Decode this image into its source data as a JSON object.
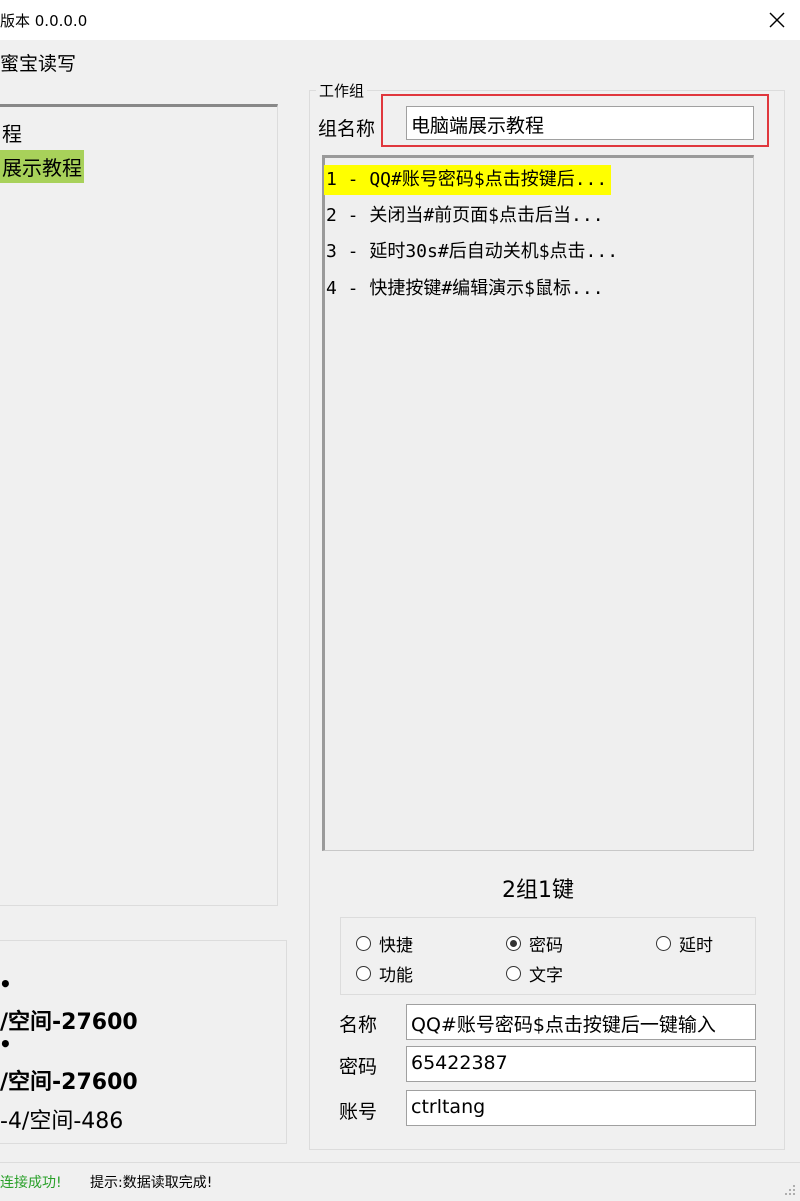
{
  "window": {
    "title": "版本 0.0.0.0",
    "close_symbol": "✕"
  },
  "menu": {
    "item": "蜜宝读写"
  },
  "tree": {
    "items": [
      {
        "label": "程"
      },
      {
        "label": "展示教程"
      }
    ]
  },
  "info": {
    "line1": "/空间-27600",
    "line2": "/空间-27600",
    "line3": "-4/空间-486"
  },
  "group": {
    "legend": "工作组",
    "name_label": "组名称",
    "name_value": "电脑端展示教程",
    "list": [
      {
        "text": "1 - QQ#账号密码$点击按键后..."
      },
      {
        "text": "2 - 关闭当#前页面$点击后当..."
      },
      {
        "text": "3 - 延时30s#后自动关机$点击..."
      },
      {
        "text": "4 - 快捷按键#编辑演示$鼠标..."
      }
    ],
    "count": "2组1键",
    "radios": [
      {
        "label": "快捷"
      },
      {
        "label": "密码"
      },
      {
        "label": "延时"
      },
      {
        "label": "功能"
      },
      {
        "label": "文字"
      }
    ],
    "selected_radio": "密码",
    "fields": {
      "name_label": "名称",
      "name_value": "QQ#账号密码$点击按键后一键输入",
      "password_label": "密码",
      "password_value": "65422387",
      "account_label": "账号",
      "account_value": "ctrltang"
    }
  },
  "status": {
    "left": "连接成功!",
    "right": "提示:数据读取完成!",
    "left_color": "#2aa02a"
  },
  "colors": {
    "selected_tree": "#a8d15a",
    "selected_list": "#ffff00",
    "highlight_border": "#e0373d"
  }
}
